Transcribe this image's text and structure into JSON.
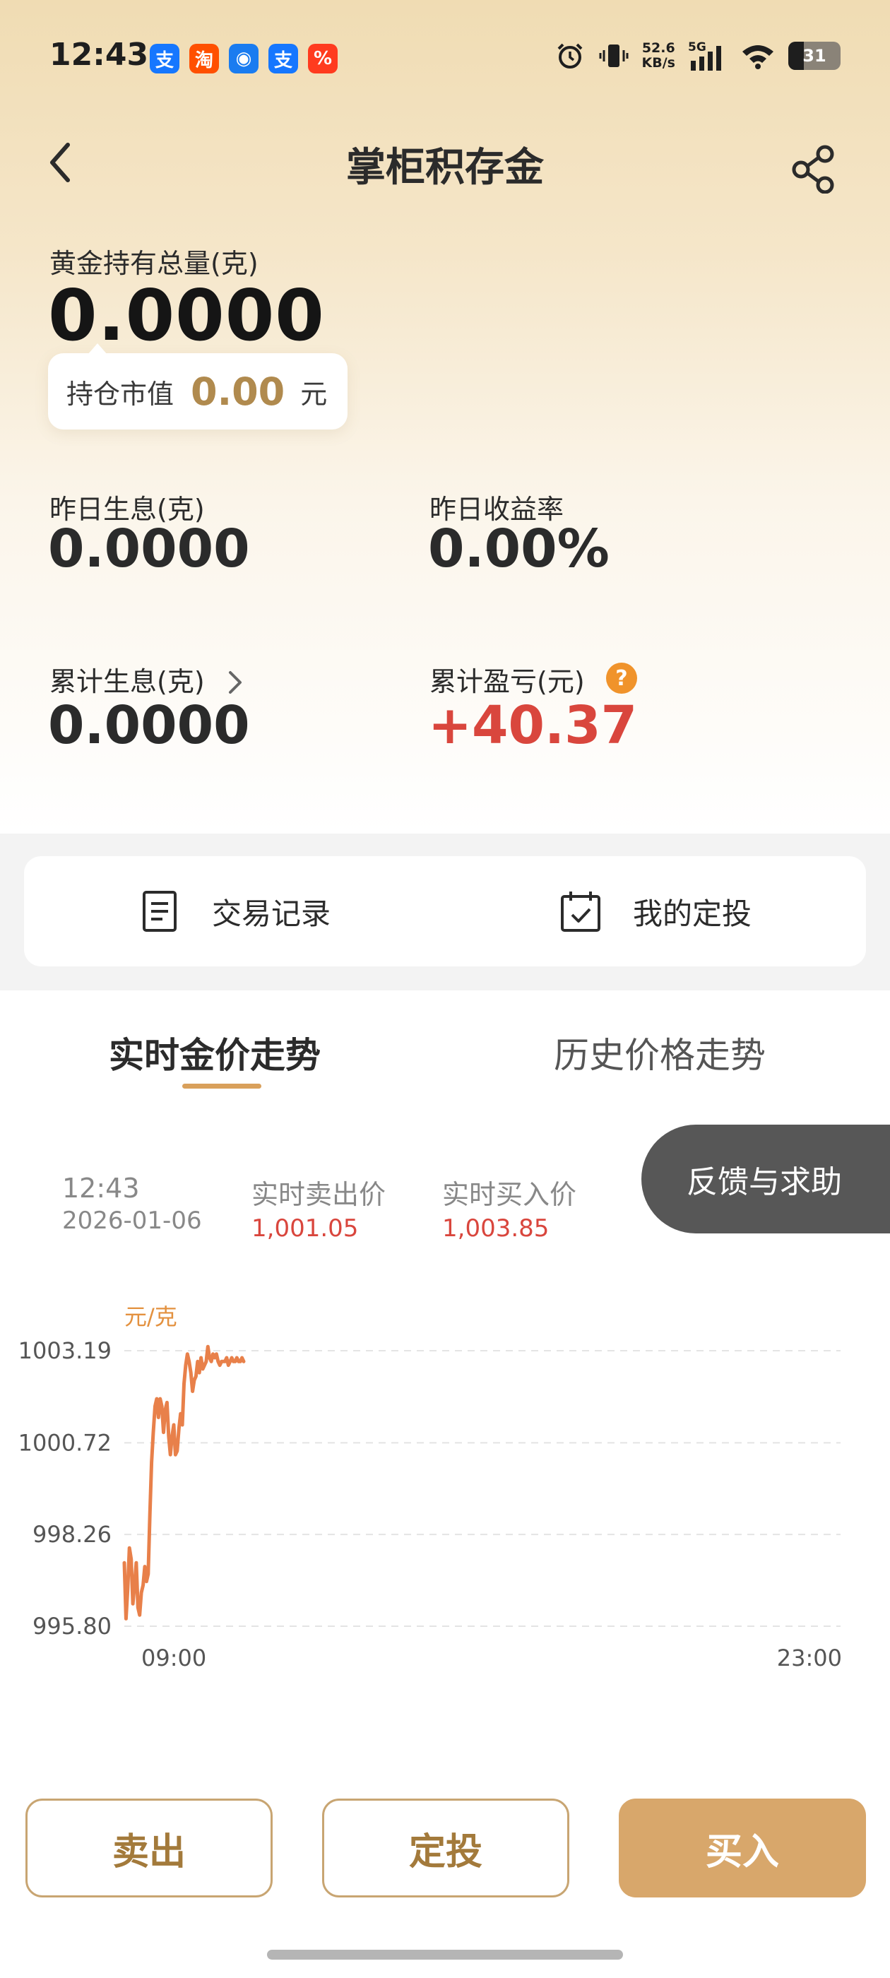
{
  "status_bar": {
    "time": "12:43",
    "app_icons": [
      {
        "name": "alipay-icon",
        "glyph": "支",
        "color": "#1677ff"
      },
      {
        "name": "taobao-icon",
        "glyph": "淘",
        "color": "#ff5000"
      },
      {
        "name": "messenger-icon",
        "glyph": "◉",
        "color": "#1a7cf0"
      },
      {
        "name": "alipay-icon",
        "glyph": "支",
        "color": "#1677ff"
      },
      {
        "name": "shopping-icon",
        "glyph": "%",
        "color": "#ff3b1f"
      }
    ],
    "net_speed_value": "52.6",
    "net_speed_unit": "KB/s",
    "network": "5G",
    "battery": "31"
  },
  "header": {
    "title": "掌柜积存金"
  },
  "holdings": {
    "total_label": "黄金持有总量(克)",
    "total_value": "0.0000",
    "market_value_label": "持仓市值",
    "market_value": "0.00",
    "market_value_unit": "元"
  },
  "stats": {
    "yesterday_interest_label": "昨日生息(克)",
    "yesterday_interest_value": "0.0000",
    "yesterday_yield_label": "昨日收益率",
    "yesterday_yield_value": "0.00%",
    "cumulative_interest_label": "累计生息(克)",
    "cumulative_interest_value": "0.0000",
    "cumulative_pnl_label": "累计盈亏(元)",
    "cumulative_pnl_value": "+40.37"
  },
  "actions": {
    "records_label": "交易记录",
    "plan_label": "我的定投"
  },
  "tabs": {
    "realtime": "实时金价走势",
    "history": "历史价格走势"
  },
  "price_info": {
    "time": "12:43",
    "date": "2026-01-06",
    "sell_label": "实时卖出价",
    "sell_value": "1,001.05",
    "buy_label": "实时买入价",
    "buy_value": "1,003.85"
  },
  "feedback_label": "反馈与求助",
  "chart_data": {
    "type": "line",
    "unit_label": "元/克",
    "y_ticks": [
      "1003.19",
      "1000.72",
      "998.26",
      "995.80"
    ],
    "ylim": [
      995.8,
      1003.19
    ],
    "x_ticks": [
      "09:00",
      "23:00"
    ],
    "xlim": [
      "09:00",
      "23:00"
    ],
    "grid": true,
    "color": "#e8804a",
    "series": [
      {
        "x": [
          "09:00",
          "09:02",
          "09:04",
          "09:06",
          "09:08",
          "09:10",
          "09:12",
          "09:14",
          "09:16",
          "09:18",
          "09:20",
          "09:22",
          "09:24",
          "09:26",
          "09:28",
          "09:30",
          "09:32",
          "09:34",
          "09:36",
          "09:38",
          "09:40",
          "09:42",
          "09:44",
          "09:46",
          "09:48",
          "09:50",
          "09:52",
          "09:54",
          "09:56",
          "09:58",
          "10:00",
          "10:02",
          "10:04",
          "10:06",
          "10:08",
          "10:10",
          "10:12",
          "10:14",
          "10:16",
          "10:18",
          "10:20",
          "10:22",
          "10:24",
          "10:26",
          "10:28",
          "10:30",
          "10:32",
          "10:34",
          "10:36",
          "10:38",
          "10:40",
          "10:42",
          "10:44",
          "10:46",
          "10:48",
          "10:50",
          "10:52",
          "10:54",
          "10:56",
          "10:58",
          "11:00",
          "11:02",
          "11:04",
          "11:06",
          "11:08",
          "11:10",
          "11:12",
          "11:14",
          "11:16",
          "11:18",
          "11:20"
        ],
        "values": [
          997.5,
          996.0,
          996.8,
          997.9,
          997.6,
          996.4,
          996.9,
          997.5,
          996.3,
          996.1,
          996.7,
          996.9,
          997.4,
          997.0,
          997.2,
          998.8,
          1000.2,
          1001.0,
          1001.7,
          1001.9,
          1001.4,
          1001.9,
          1001.7,
          1001.0,
          1001.6,
          1001.8,
          1000.9,
          1000.4,
          1000.9,
          1001.2,
          1000.4,
          1000.5,
          1001.1,
          1001.5,
          1001.2,
          1002.3,
          1002.8,
          1003.1,
          1002.9,
          1002.6,
          1002.1,
          1002.4,
          1002.5,
          1002.9,
          1002.6,
          1003.0,
          1002.7,
          1002.8,
          1002.9,
          1003.3,
          1003.0,
          1002.9,
          1003.1,
          1003.0,
          1003.1,
          1002.9,
          1002.8,
          1002.9,
          1002.9,
          1002.9,
          1003.0,
          1002.8,
          1002.9,
          1003.0,
          1002.9,
          1002.9,
          1003.0,
          1002.9,
          1002.9,
          1003.0,
          1002.9
        ]
      }
    ]
  },
  "bottom_buttons": {
    "sell": "卖出",
    "plan": "定投",
    "buy": "买入"
  }
}
